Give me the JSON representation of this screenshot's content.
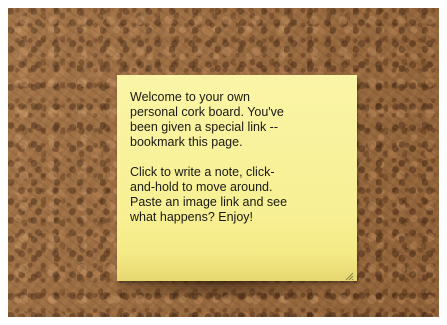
{
  "board": {
    "background": "cork-texture",
    "note": {
      "text": "Welcome to your own\npersonal cork board. You've\nbeen given a special link --\nbookmark this page.\n\nClick to write a note, click-\nand-hold to move around.\nPaste an image link and see\nwhat happens? Enjoy!",
      "color": "#f9f3a0",
      "resize_icon": "resize-grip-icon"
    }
  }
}
